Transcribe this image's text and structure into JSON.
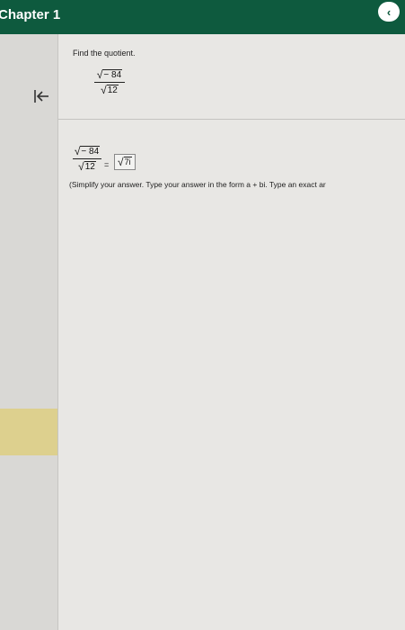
{
  "header": {
    "chapter_title": "Chapter 1",
    "back_icon": "chevron-left-icon",
    "back_glyph": "‹"
  },
  "sidebar": {
    "collapse_icon": "collapse-left-icon"
  },
  "question": {
    "prompt": "Find the quotient.",
    "fraction": {
      "numerator_radicand": "− 84",
      "denominator_radicand": "12"
    }
  },
  "answer": {
    "fraction": {
      "numerator_radicand": "− 84",
      "denominator_radicand": "12"
    },
    "equals": "=",
    "input_radicand": "7i",
    "instruction": "(Simplify your answer. Type your answer in the form a + bi. Type an exact ar"
  },
  "colors": {
    "header_bg": "#0e5a3e",
    "page_bg": "#e8e7e4",
    "highlight_tab": "#ddd08e"
  }
}
